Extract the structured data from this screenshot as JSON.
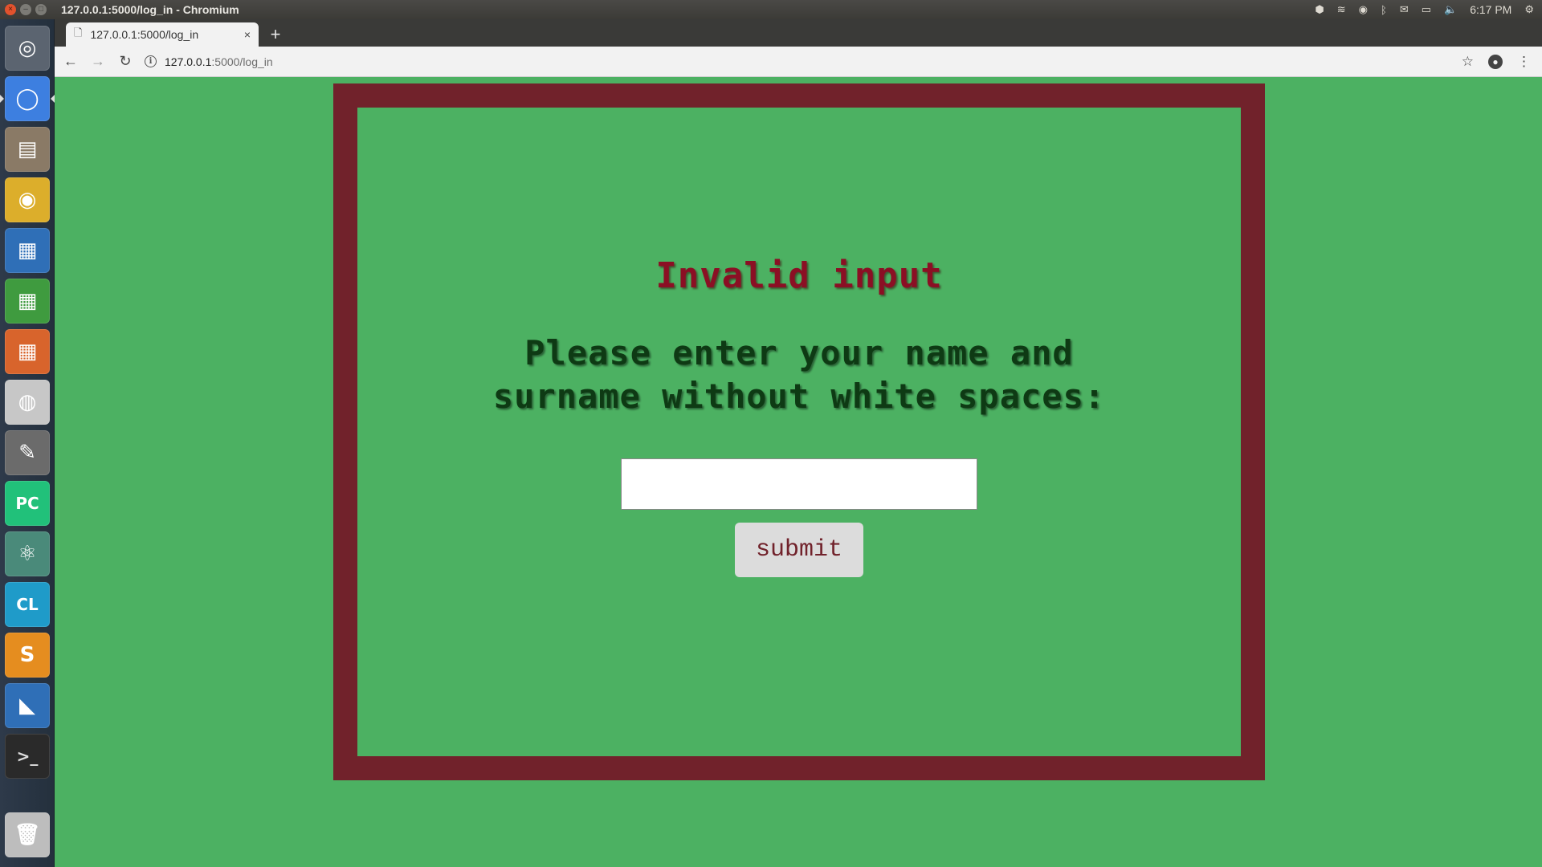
{
  "system_bar": {
    "window_title": "127.0.0.1:5000/log_in - Chromium",
    "clock": "6:17 PM",
    "close_glyph": "×",
    "minimize_glyph": "–",
    "maximize_glyph": "□",
    "tray_icons": {
      "apps": "⬢",
      "wifi": "≋",
      "chrome": "◉",
      "bluetooth": "ᛒ",
      "mail": "✉",
      "battery": "▭",
      "volume": "🔈",
      "settings": "⚙"
    }
  },
  "launcher": {
    "items": [
      {
        "name": "ubuntu-dash",
        "glyph": "◎",
        "bg": "#5b6470"
      },
      {
        "name": "chromium",
        "glyph": "◯",
        "bg": "#3d7fe0"
      },
      {
        "name": "files",
        "glyph": "▤",
        "bg": "#8a7a66"
      },
      {
        "name": "google-chrome",
        "glyph": "◉",
        "bg": "#dcae2b"
      },
      {
        "name": "libreoffice-writer",
        "glyph": "▦",
        "bg": "#2f6fb7"
      },
      {
        "name": "libreoffice-calc",
        "glyph": "▦",
        "bg": "#3f9b3f"
      },
      {
        "name": "libreoffice-impress",
        "glyph": "▦",
        "bg": "#d8642c"
      },
      {
        "name": "software-center",
        "glyph": "◍",
        "bg": "#c7c7c7"
      },
      {
        "name": "system-settings",
        "glyph": "✎",
        "bg": "#6b6b6b"
      },
      {
        "name": "pycharm",
        "glyph": "PC",
        "bg": "#21c17a"
      },
      {
        "name": "atom",
        "glyph": "⚛",
        "bg": "#4a8a7a"
      },
      {
        "name": "clion",
        "glyph": "CL",
        "bg": "#1f9bc9"
      },
      {
        "name": "sublime-text",
        "glyph": "S",
        "bg": "#e58d1f"
      },
      {
        "name": "vscode",
        "glyph": "◣",
        "bg": "#2f6fb7"
      },
      {
        "name": "terminal",
        "glyph": ">_",
        "bg": "#2a2a2a"
      },
      {
        "name": "trash",
        "glyph": "🗑",
        "bg": "#bdbdbd"
      }
    ]
  },
  "browser": {
    "tab": {
      "title": "127.0.0.1:5000/log_in",
      "favicon": "🗋",
      "close_glyph": "×"
    },
    "new_tab_glyph": "+",
    "nav": {
      "back": "←",
      "forward": "→",
      "reload": "↻"
    },
    "omnibox": {
      "info_glyph": "i",
      "host": "127.0.0.1",
      "path": ":5000/log_in"
    },
    "bookmark_glyph": "☆",
    "account_glyph": "●",
    "menu_glyph": "⋮"
  },
  "page": {
    "error_heading": "Invalid input",
    "prompt_heading": "Please enter your name and surname without white spaces:",
    "name_input_value": "",
    "submit_label": "submit"
  },
  "colors": {
    "page_background": "#4cb162",
    "frame_border": "#71222b",
    "error_text": "#8b0f24",
    "prompt_text": "#0e3a14",
    "button_background": "#dcdcdc"
  }
}
